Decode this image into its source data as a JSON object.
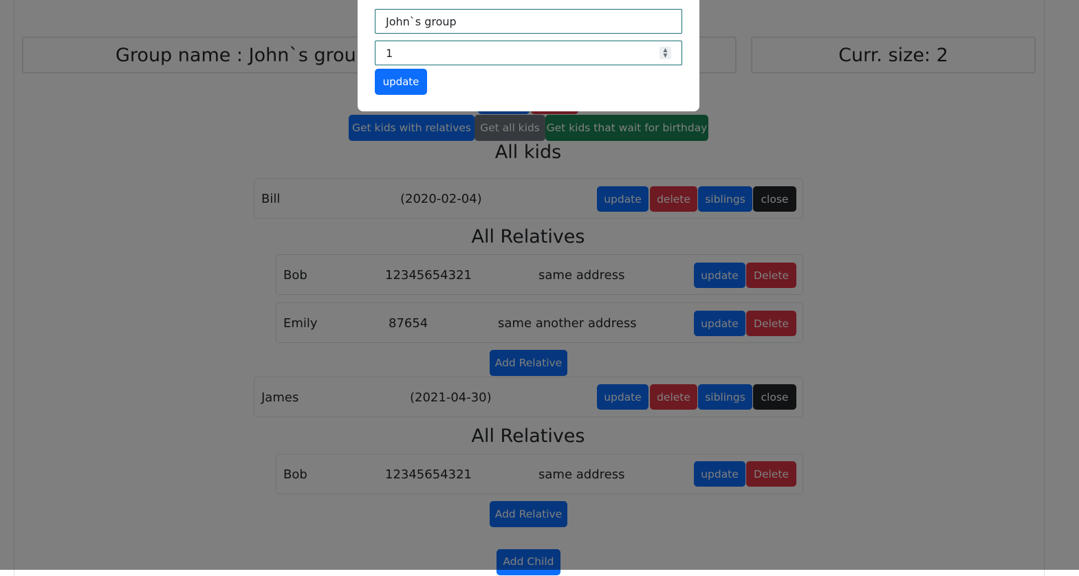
{
  "header": {
    "group_name": "Group name : John`s group",
    "curr_size": "Curr. size: 2"
  },
  "filters": {
    "with_relatives": "Get kids with relatives",
    "all_kids": "Get all kids",
    "birthday": "Get kids that wait for birthday"
  },
  "kids_heading": "All kids",
  "relatives_heading": "All Relatives",
  "kid_actions": {
    "update": "update",
    "delete": "delete",
    "siblings": "siblings",
    "close": "close"
  },
  "relative_actions": {
    "update": "update",
    "delete": "Delete"
  },
  "add_relative_label": "Add Relative",
  "add_child_label": "Add Child",
  "kids": [
    {
      "name": "Bill",
      "birthday": "(2020-02-04)",
      "relatives": [
        {
          "name": "Bob",
          "phone": "12345654321",
          "address": "same address"
        },
        {
          "name": "Emily",
          "phone": "87654",
          "address": "same another address"
        }
      ]
    },
    {
      "name": "James",
      "birthday": "(2021-04-30)",
      "relatives": [
        {
          "name": "Bob",
          "phone": "12345654321",
          "address": "same address"
        }
      ]
    }
  ],
  "modal": {
    "name_value": "John`s group",
    "size_value": "1",
    "update_label": "update"
  },
  "colors": {
    "primary": "#0d6efd",
    "danger": "#dc3545",
    "dark": "#212529",
    "secondary": "#6c757d",
    "success": "#198754",
    "overlay": "rgba(0,0,0,0.5)"
  }
}
